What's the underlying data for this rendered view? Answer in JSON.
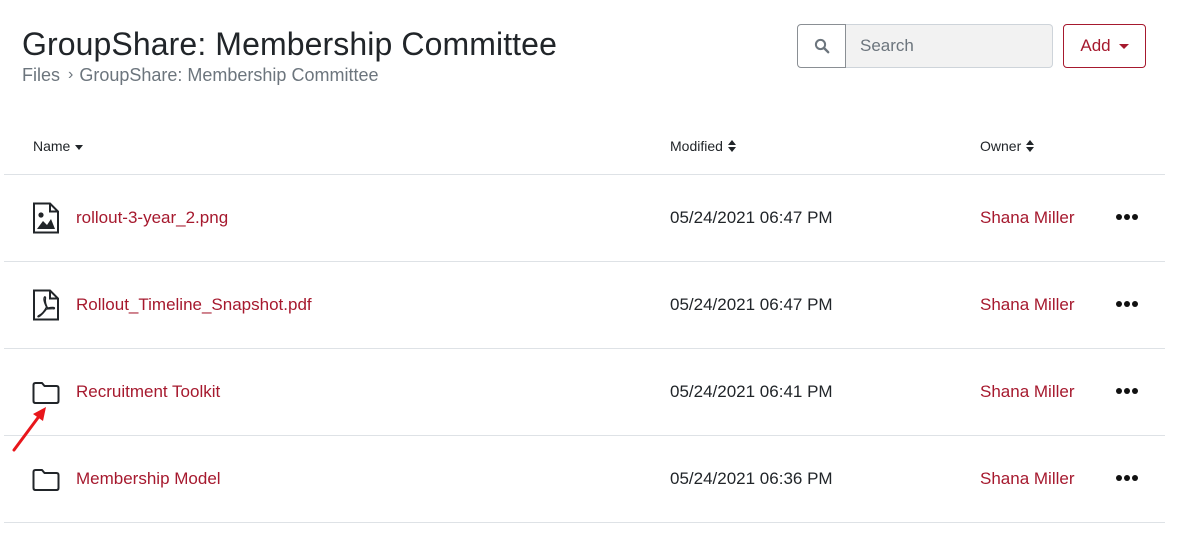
{
  "header": {
    "title": "GroupShare: Membership Committee",
    "breadcrumb": {
      "root": "Files",
      "separator": "›",
      "current": "GroupShare: Membership Committee"
    }
  },
  "search": {
    "placeholder": "Search",
    "value": "",
    "icon": "search-icon"
  },
  "add_button": {
    "label": "Add",
    "icon": "caret-down-icon"
  },
  "table": {
    "columns": [
      {
        "label": "Name",
        "sort": "descending"
      },
      {
        "label": "Modified",
        "sort": "both"
      },
      {
        "label": "Owner",
        "sort": "both"
      }
    ],
    "rows": [
      {
        "type": "image",
        "icon": "image-file-icon",
        "name": "rollout-3-year_2.png",
        "modified": "05/24/2021 06:47 PM",
        "owner": "Shana Miller"
      },
      {
        "type": "pdf",
        "icon": "pdf-file-icon",
        "name": "Rollout_Timeline_Snapshot.pdf",
        "modified": "05/24/2021 06:47 PM",
        "owner": "Shana Miller"
      },
      {
        "type": "folder",
        "icon": "folder-icon",
        "name": "Recruitment Toolkit",
        "modified": "05/24/2021 06:41 PM",
        "owner": "Shana Miller"
      },
      {
        "type": "folder",
        "icon": "folder-icon",
        "name": "Membership Model",
        "modified": "05/24/2021 06:36 PM",
        "owner": "Shana Miller"
      }
    ]
  },
  "colors": {
    "accent": "#a6192e",
    "annotation": "#e8161b",
    "text": "#212529",
    "muted": "#6c757d"
  }
}
